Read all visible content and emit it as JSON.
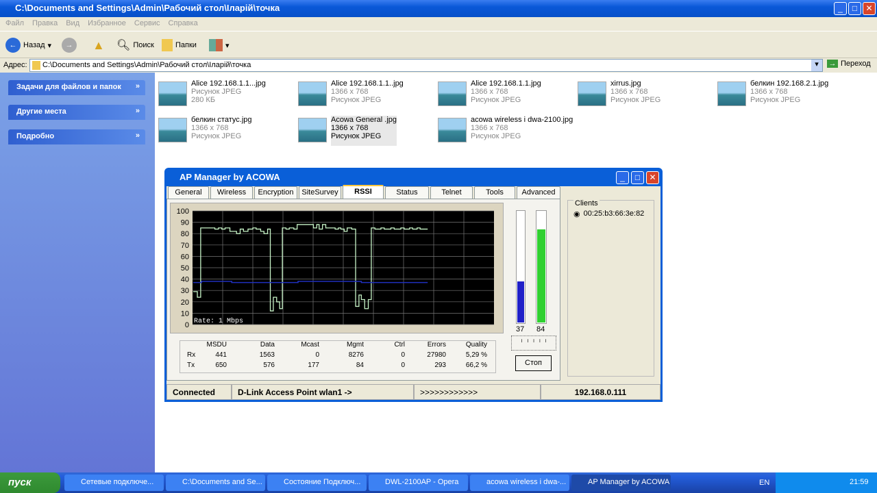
{
  "explorer": {
    "title": "C:\\Documents and Settings\\Admin\\Рабочий стол\\Ілapiй\\точка",
    "menu": [
      "Файл",
      "Правка",
      "Вид",
      "Избранное",
      "Сервис",
      "Справка"
    ],
    "toolbar": {
      "back": "Назад",
      "search": "Поиск",
      "folders": "Папки"
    },
    "address_label": "Адрес:",
    "address": "C:\\Documents and Settings\\Admin\\Рабочий стол\\Ілapiй\\точка",
    "go": "Переход",
    "sidebar": [
      "Задачи для файлов и папок",
      "Другие места",
      "Подробно"
    ],
    "files": [
      {
        "name": "Alice 192.168.1.1...jpg",
        "l2": "Рисунок JPEG",
        "l3": "280 КБ"
      },
      {
        "name": "Alice 192.168.1.1..jpg",
        "l2": "1366 x 768",
        "l3": "Рисунок JPEG"
      },
      {
        "name": "Alice 192.168.1.1.jpg",
        "l2": "1366 x 768",
        "l3": "Рисунок JPEG"
      },
      {
        "name": "xirrus.jpg",
        "l2": "1366 x 768",
        "l3": "Рисунок JPEG"
      },
      {
        "name": "белкин  192.168.2.1.jpg",
        "l2": "1366 x 768",
        "l3": "Рисунок JPEG"
      },
      {
        "name": "белкин  статус.jpg",
        "l2": "1366 x 768",
        "l3": "Рисунок JPEG"
      },
      {
        "name": "Acowa General .jpg",
        "l2": "1366 x 768",
        "l3": "Рисунок JPEG"
      },
      {
        "name": "acowa wireless i dwa-2100.jpg",
        "l2": "1366 x 768",
        "l3": "Рисунок JPEG"
      }
    ]
  },
  "ap": {
    "title": "AP Manager by ACOWA",
    "tabs": [
      "General",
      "Wireless",
      "Encryption",
      "SiteSurvey",
      "RSSI",
      "Status",
      "Telnet",
      "Tools",
      "Advanced"
    ],
    "active_tab": "RSSI",
    "rate_label": "Rate:     1 Mbps",
    "bars": {
      "blue": 37,
      "green": 84,
      "blue_label": "37",
      "green_label": "84"
    },
    "stats": {
      "headers": [
        "MSDU",
        "Data",
        "Mcast",
        "Mgmt",
        "Ctrl",
        "Errors",
        "Quality"
      ],
      "rows": [
        {
          "label": "Rx",
          "values": [
            "441",
            "1563",
            "0",
            "8276",
            "0",
            "27980",
            "5,29 %"
          ]
        },
        {
          "label": "Tx",
          "values": [
            "650",
            "576",
            "177",
            "84",
            "0",
            "293",
            "66,2 %"
          ]
        }
      ]
    },
    "stop": "Стоп",
    "clients_label": "Clients",
    "clients": [
      "00:25:b3:66:3e:82"
    ],
    "status": {
      "state": "Connected",
      "device": "D-Link Access Point wlan1 ->",
      "progress": ">>>>>>>>>>>>",
      "ip": "192.168.0.111"
    }
  },
  "chart_data": {
    "type": "line",
    "title": "RSSI",
    "xlabel": "",
    "ylabel": "",
    "ylim": [
      0,
      100
    ],
    "xlim": [
      0,
      100
    ],
    "yticks": [
      "0",
      "10",
      "20",
      "30",
      "40",
      "50",
      "60",
      "70",
      "80",
      "90",
      "100"
    ],
    "series": [
      {
        "name": "signal",
        "color": "#c8f5c8",
        "steps": [
          [
            0.2,
            29
          ],
          [
            1.6,
            24
          ],
          [
            2.7,
            85
          ],
          [
            7.4,
            84
          ],
          [
            8.6,
            85
          ],
          [
            9.7,
            84
          ],
          [
            10.8,
            85
          ],
          [
            12.4,
            82
          ],
          [
            14.6,
            80
          ],
          [
            15.8,
            84
          ],
          [
            16.9,
            82
          ],
          [
            18.4,
            84
          ],
          [
            20,
            85
          ],
          [
            21.1,
            84
          ],
          [
            22.6,
            82
          ],
          [
            23.7,
            80
          ],
          [
            24.9,
            84
          ],
          [
            25.8,
            12
          ],
          [
            26.8,
            24
          ],
          [
            27.9,
            20
          ],
          [
            28.9,
            14
          ],
          [
            29.8,
            85
          ],
          [
            31,
            84
          ],
          [
            32.1,
            85
          ],
          [
            33.6,
            84
          ],
          [
            34.7,
            88
          ],
          [
            40.1,
            85
          ],
          [
            41.2,
            88
          ],
          [
            42,
            84
          ],
          [
            43.1,
            88
          ],
          [
            44.2,
            85
          ],
          [
            47.3,
            84
          ],
          [
            48.4,
            85
          ],
          [
            49.2,
            84
          ],
          [
            50.3,
            82
          ],
          [
            51.3,
            85
          ],
          [
            52.8,
            84
          ],
          [
            54.1,
            16
          ],
          [
            55.2,
            26
          ],
          [
            56,
            22
          ],
          [
            57.1,
            14
          ],
          [
            58.3,
            22
          ],
          [
            59.3,
            85
          ],
          [
            60.5,
            84
          ],
          [
            62.5,
            85
          ],
          [
            63.6,
            84
          ],
          [
            65.8,
            85
          ],
          [
            66.9,
            84
          ],
          [
            69.1,
            85
          ],
          [
            70.2,
            84
          ],
          [
            72,
            85
          ],
          [
            73,
            84
          ],
          [
            74.5,
            85
          ],
          [
            75.5,
            84
          ],
          [
            78,
            84
          ]
        ]
      },
      {
        "name": "noise",
        "color": "#2030c0",
        "steps": [
          [
            0.2,
            37
          ],
          [
            3,
            38
          ],
          [
            13,
            37
          ],
          [
            29,
            37
          ],
          [
            35,
            38
          ],
          [
            56,
            37
          ],
          [
            78,
            37
          ]
        ]
      }
    ]
  },
  "taskbar": {
    "start": "пуск",
    "tasks": [
      "Сетевые подключе...",
      "C:\\Documents and Se...",
      "Состояние Подключ...",
      "DWL-2100AP - Opera",
      "acowa wireless i dwa-...",
      "AP Manager by ACOWA"
    ],
    "lang": "EN",
    "clock": "21:59"
  }
}
